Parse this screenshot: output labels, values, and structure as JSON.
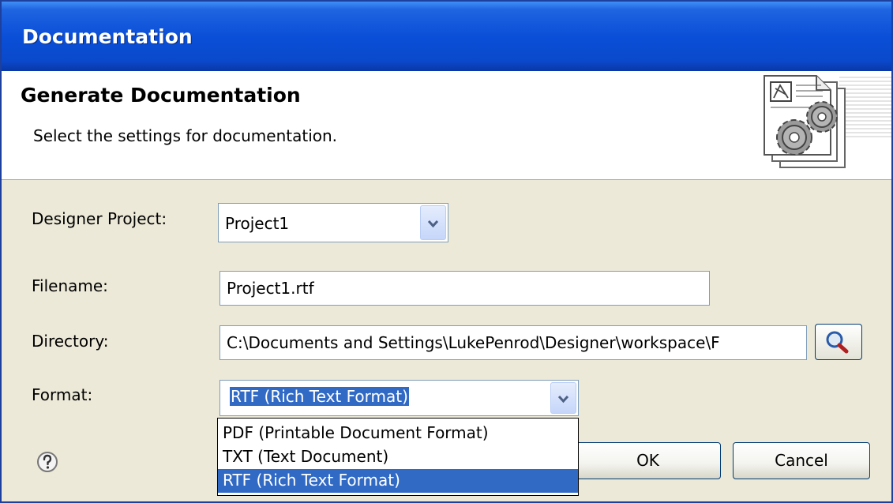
{
  "window": {
    "title": "Documentation"
  },
  "header": {
    "title": "Generate Documentation",
    "description": "Select the settings for documentation."
  },
  "form": {
    "designer_project": {
      "label": "Designer Project:",
      "value": "Project1"
    },
    "filename": {
      "label": "Filename:",
      "value": "Project1.rtf"
    },
    "directory": {
      "label": "Directory:",
      "value": "C:\\Documents and Settings\\LukePenrod\\Designer\\workspace\\F"
    },
    "format": {
      "label": "Format:",
      "value": "RTF (Rich Text Format)",
      "options": [
        "PDF (Printable Document Format)",
        "TXT (Text Document)",
        "RTF (Rich Text Format)"
      ],
      "selected_index": 2
    }
  },
  "buttons": {
    "ok": "OK",
    "cancel": "Cancel"
  },
  "icons": {
    "browse": "magnifier-icon",
    "help": "help-icon",
    "header": "document-gears-icon",
    "dropdown": "chevron-down-icon"
  },
  "colors": {
    "titlebar": "#0a4fd8",
    "dialog_bg": "#ece9d8",
    "selection": "#316ac5",
    "field_border": "#7f9db9"
  }
}
